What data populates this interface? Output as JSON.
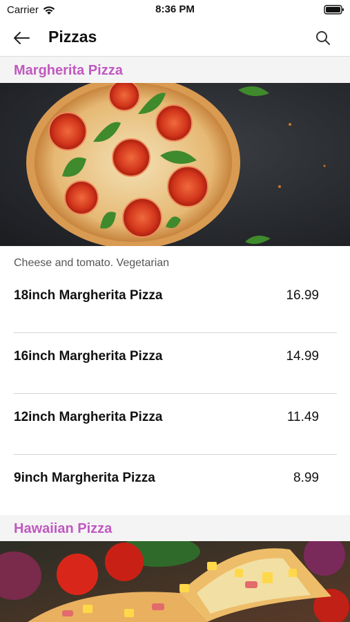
{
  "status_bar": {
    "carrier": "Carrier",
    "time": "8:36 PM"
  },
  "nav": {
    "title": "Pizzas",
    "back_icon": "arrow-left-icon",
    "search_icon": "search-icon"
  },
  "sections": [
    {
      "title": "Margherita Pizza",
      "description": "Cheese and tomato. Vegetarian",
      "items": [
        {
          "name": "18inch Margherita Pizza",
          "price": "16.99"
        },
        {
          "name": "16inch Margherita Pizza",
          "price": "14.99"
        },
        {
          "name": "12inch Margherita Pizza",
          "price": "11.49"
        },
        {
          "name": "9inch Margherita Pizza",
          "price": "8.99"
        }
      ]
    },
    {
      "title": "Hawaiian Pizza"
    }
  ],
  "colors": {
    "accent": "#c058c0",
    "section_background": "#f4f4f4",
    "divider": "#d2d2d2"
  }
}
